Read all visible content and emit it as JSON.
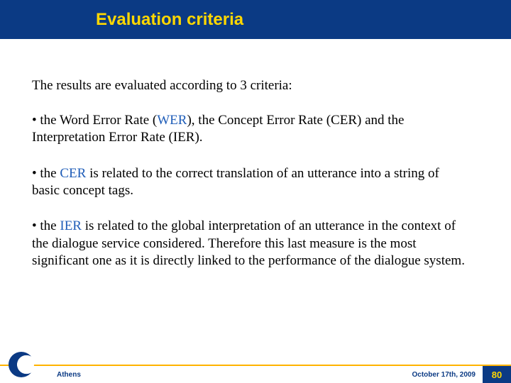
{
  "header": {
    "title": "Evaluation criteria"
  },
  "content": {
    "intro": "The results are evaluated according to 3 criteria:",
    "bullets": {
      "b1": {
        "prefix": "• the Word Error Rate (",
        "accent": "WER",
        "suffix": "), the Concept Error Rate (CER) and the Interpretation Error Rate (IER)."
      },
      "b2": {
        "prefix": "• the ",
        "accent": "CER",
        "suffix": " is related to the correct translation of an utterance into a string of basic concept tags."
      },
      "b3": {
        "prefix": "• the ",
        "accent": "IER",
        "suffix": " is related to the global interpretation of an utterance in the context of the dialogue service considered. Therefore this last measure is the most significant one as it is directly linked to the performance of the dialogue system."
      }
    }
  },
  "footer": {
    "left": "Athens",
    "right": "October 17th,  2009",
    "page": "80"
  }
}
